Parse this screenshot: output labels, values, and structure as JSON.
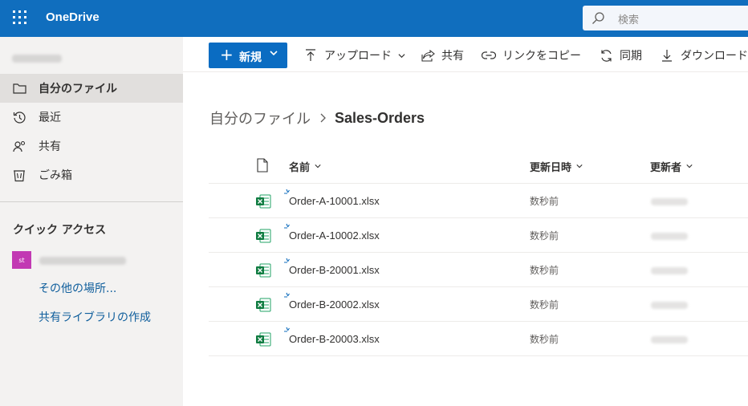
{
  "header": {
    "app_name": "OneDrive",
    "search_placeholder": "検索",
    "brand_color": "#106ebe"
  },
  "nav": {
    "items": [
      {
        "label": "自分のファイル",
        "icon": "folder-icon",
        "selected": true
      },
      {
        "label": "最近",
        "icon": "history-icon",
        "selected": false
      },
      {
        "label": "共有",
        "icon": "people-icon",
        "selected": false
      },
      {
        "label": "ごみ箱",
        "icon": "trash-icon",
        "selected": false
      }
    ],
    "quick_access_title": "クイック アクセス",
    "quick_access_site_initials": "st",
    "links": [
      "その他の場所...",
      "共有ライブラリの作成"
    ]
  },
  "commands": {
    "new_label": "新規",
    "upload": "アップロード",
    "share": "共有",
    "copy_link": "リンクをコピー",
    "sync": "同期",
    "download": "ダウンロード"
  },
  "breadcrumb": {
    "root": "自分のファイル",
    "current": "Sales-Orders"
  },
  "columns": {
    "name": "名前",
    "modified": "更新日時",
    "modified_by": "更新者"
  },
  "files": [
    {
      "name": "Order-A-10001.xlsx",
      "modified": "数秒前"
    },
    {
      "name": "Order-A-10002.xlsx",
      "modified": "数秒前"
    },
    {
      "name": "Order-B-20001.xlsx",
      "modified": "数秒前"
    },
    {
      "name": "Order-B-20002.xlsx",
      "modified": "数秒前"
    },
    {
      "name": "Order-B-20003.xlsx",
      "modified": "数秒前"
    }
  ]
}
